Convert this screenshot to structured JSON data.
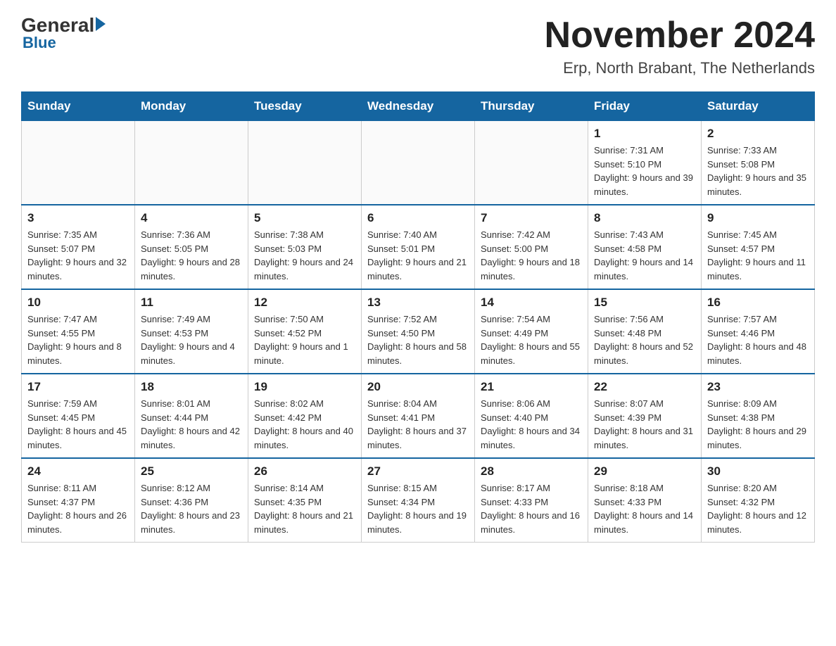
{
  "logo": {
    "general": "General",
    "blue": "Blue"
  },
  "title": "November 2024",
  "subtitle": "Erp, North Brabant, The Netherlands",
  "days_of_week": [
    "Sunday",
    "Monday",
    "Tuesday",
    "Wednesday",
    "Thursday",
    "Friday",
    "Saturday"
  ],
  "weeks": [
    [
      {
        "day": "",
        "info": ""
      },
      {
        "day": "",
        "info": ""
      },
      {
        "day": "",
        "info": ""
      },
      {
        "day": "",
        "info": ""
      },
      {
        "day": "",
        "info": ""
      },
      {
        "day": "1",
        "info": "Sunrise: 7:31 AM\nSunset: 5:10 PM\nDaylight: 9 hours and 39 minutes."
      },
      {
        "day": "2",
        "info": "Sunrise: 7:33 AM\nSunset: 5:08 PM\nDaylight: 9 hours and 35 minutes."
      }
    ],
    [
      {
        "day": "3",
        "info": "Sunrise: 7:35 AM\nSunset: 5:07 PM\nDaylight: 9 hours and 32 minutes."
      },
      {
        "day": "4",
        "info": "Sunrise: 7:36 AM\nSunset: 5:05 PM\nDaylight: 9 hours and 28 minutes."
      },
      {
        "day": "5",
        "info": "Sunrise: 7:38 AM\nSunset: 5:03 PM\nDaylight: 9 hours and 24 minutes."
      },
      {
        "day": "6",
        "info": "Sunrise: 7:40 AM\nSunset: 5:01 PM\nDaylight: 9 hours and 21 minutes."
      },
      {
        "day": "7",
        "info": "Sunrise: 7:42 AM\nSunset: 5:00 PM\nDaylight: 9 hours and 18 minutes."
      },
      {
        "day": "8",
        "info": "Sunrise: 7:43 AM\nSunset: 4:58 PM\nDaylight: 9 hours and 14 minutes."
      },
      {
        "day": "9",
        "info": "Sunrise: 7:45 AM\nSunset: 4:57 PM\nDaylight: 9 hours and 11 minutes."
      }
    ],
    [
      {
        "day": "10",
        "info": "Sunrise: 7:47 AM\nSunset: 4:55 PM\nDaylight: 9 hours and 8 minutes."
      },
      {
        "day": "11",
        "info": "Sunrise: 7:49 AM\nSunset: 4:53 PM\nDaylight: 9 hours and 4 minutes."
      },
      {
        "day": "12",
        "info": "Sunrise: 7:50 AM\nSunset: 4:52 PM\nDaylight: 9 hours and 1 minute."
      },
      {
        "day": "13",
        "info": "Sunrise: 7:52 AM\nSunset: 4:50 PM\nDaylight: 8 hours and 58 minutes."
      },
      {
        "day": "14",
        "info": "Sunrise: 7:54 AM\nSunset: 4:49 PM\nDaylight: 8 hours and 55 minutes."
      },
      {
        "day": "15",
        "info": "Sunrise: 7:56 AM\nSunset: 4:48 PM\nDaylight: 8 hours and 52 minutes."
      },
      {
        "day": "16",
        "info": "Sunrise: 7:57 AM\nSunset: 4:46 PM\nDaylight: 8 hours and 48 minutes."
      }
    ],
    [
      {
        "day": "17",
        "info": "Sunrise: 7:59 AM\nSunset: 4:45 PM\nDaylight: 8 hours and 45 minutes."
      },
      {
        "day": "18",
        "info": "Sunrise: 8:01 AM\nSunset: 4:44 PM\nDaylight: 8 hours and 42 minutes."
      },
      {
        "day": "19",
        "info": "Sunrise: 8:02 AM\nSunset: 4:42 PM\nDaylight: 8 hours and 40 minutes."
      },
      {
        "day": "20",
        "info": "Sunrise: 8:04 AM\nSunset: 4:41 PM\nDaylight: 8 hours and 37 minutes."
      },
      {
        "day": "21",
        "info": "Sunrise: 8:06 AM\nSunset: 4:40 PM\nDaylight: 8 hours and 34 minutes."
      },
      {
        "day": "22",
        "info": "Sunrise: 8:07 AM\nSunset: 4:39 PM\nDaylight: 8 hours and 31 minutes."
      },
      {
        "day": "23",
        "info": "Sunrise: 8:09 AM\nSunset: 4:38 PM\nDaylight: 8 hours and 29 minutes."
      }
    ],
    [
      {
        "day": "24",
        "info": "Sunrise: 8:11 AM\nSunset: 4:37 PM\nDaylight: 8 hours and 26 minutes."
      },
      {
        "day": "25",
        "info": "Sunrise: 8:12 AM\nSunset: 4:36 PM\nDaylight: 8 hours and 23 minutes."
      },
      {
        "day": "26",
        "info": "Sunrise: 8:14 AM\nSunset: 4:35 PM\nDaylight: 8 hours and 21 minutes."
      },
      {
        "day": "27",
        "info": "Sunrise: 8:15 AM\nSunset: 4:34 PM\nDaylight: 8 hours and 19 minutes."
      },
      {
        "day": "28",
        "info": "Sunrise: 8:17 AM\nSunset: 4:33 PM\nDaylight: 8 hours and 16 minutes."
      },
      {
        "day": "29",
        "info": "Sunrise: 8:18 AM\nSunset: 4:33 PM\nDaylight: 8 hours and 14 minutes."
      },
      {
        "day": "30",
        "info": "Sunrise: 8:20 AM\nSunset: 4:32 PM\nDaylight: 8 hours and 12 minutes."
      }
    ]
  ]
}
